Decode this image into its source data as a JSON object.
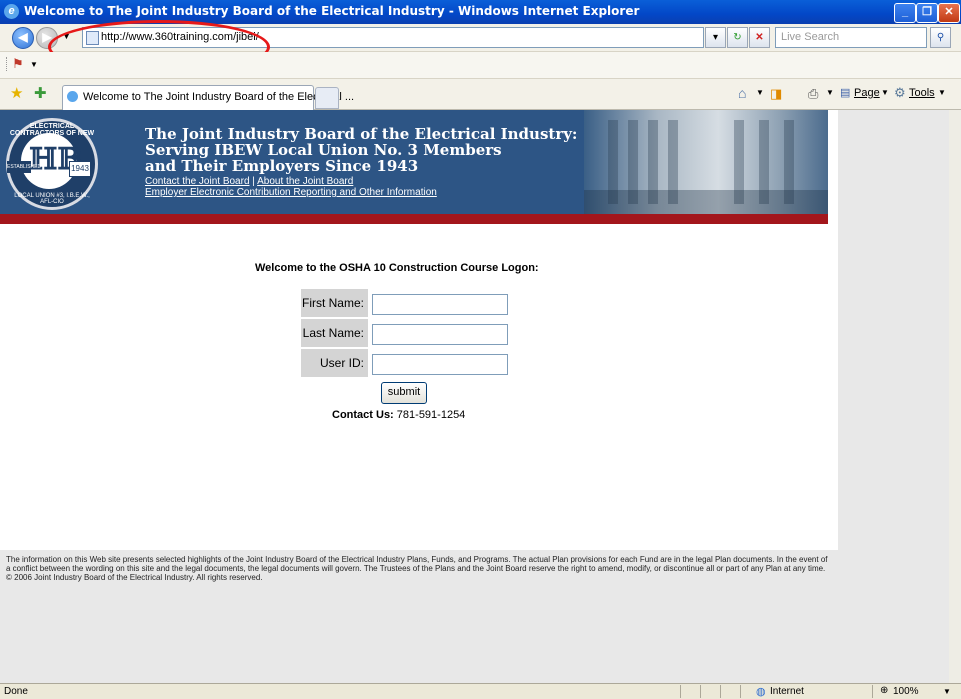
{
  "window": {
    "title": "Welcome to The Joint Industry Board of the Electrical Industry - Windows Internet Explorer"
  },
  "address": {
    "url": "http://www.360training.com/jibei/",
    "search_placeholder": "Live Search"
  },
  "tab": {
    "label": "Welcome to The Joint Industry Board of the Electrical ..."
  },
  "toolbar": {
    "page_label": "Page",
    "tools_label": "Tools"
  },
  "banner": {
    "heading": [
      "The Joint Industry Board of the Electrical Industry:",
      "Serving IBEW Local Union No. 3 Members",
      "and Their Employers Since 1943"
    ],
    "links": [
      "Contact the Joint Board",
      "About the Joint Board",
      "Employer Electronic Contribution Reporting and Other Information"
    ],
    "link_separator": "|",
    "seal_top": "ELECTRICAL CONTRACTORS OF NEW YORK",
    "seal_est": "ESTABLISHED",
    "seal_year": "1943",
    "seal_bottom": "LOCAL UNION #3, I.B.E.W., AFL-CIO"
  },
  "form": {
    "heading": "Welcome to the OSHA 10 Construction Course Logon:",
    "fields": [
      {
        "label": "First Name:",
        "value": ""
      },
      {
        "label": "Last Name:",
        "value": ""
      },
      {
        "label": "User ID:",
        "value": ""
      }
    ],
    "submit_label": "submit",
    "contact_label": "Contact Us:",
    "contact_phone": "781-591-1254"
  },
  "footer": {
    "text": "The information on this Web site presents selected highlights of the Joint Industry Board of the Electrical Industry Plans, Funds, and Programs. The actual Plan provisions for each Fund are in the legal Plan documents. In the event of a conflict between the wording on this site and the legal documents, the legal documents will govern. The Trustees of the Plans and the Joint Board reserve the right to amend, modify, or discontinue all or part of any Plan at any time. © 2006 Joint Industry Board of the Electrical Industry. All rights reserved."
  },
  "status": {
    "left": "Done",
    "zone": "Internet",
    "zoom": "100%"
  },
  "colors": {
    "banner_blue": "#2d5585",
    "banner_red": "#a3161c",
    "highlight_oval": "#e61919"
  }
}
